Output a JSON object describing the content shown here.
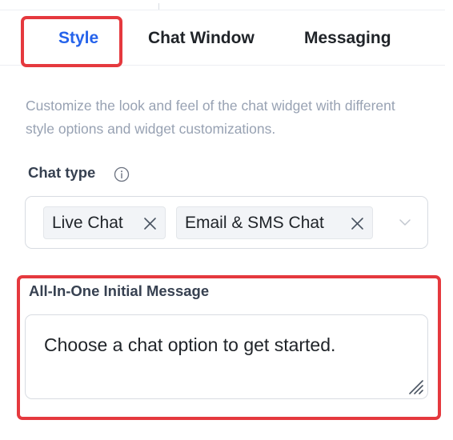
{
  "tabs": [
    {
      "label": "Style",
      "active": true
    },
    {
      "label": "Chat Window",
      "active": false
    },
    {
      "label": "Messaging",
      "active": false
    }
  ],
  "description": "Customize the look and feel of the chat widget with different style options and widget customizations.",
  "chat_type": {
    "label": "Chat type",
    "info_icon": "info-circle-icon",
    "selected": [
      {
        "label": "Live Chat"
      },
      {
        "label": "Email & SMS Chat"
      }
    ],
    "dropdown_icon": "chevron-down-icon"
  },
  "initial_message": {
    "label": "All-In-One Initial Message",
    "value": "Choose a chat option to get started."
  },
  "colors": {
    "accent": "#2563eb",
    "highlight": "#e5393e",
    "muted_text": "#98a2b3",
    "chip_bg": "#f2f4f7",
    "border": "#d8dce2"
  }
}
